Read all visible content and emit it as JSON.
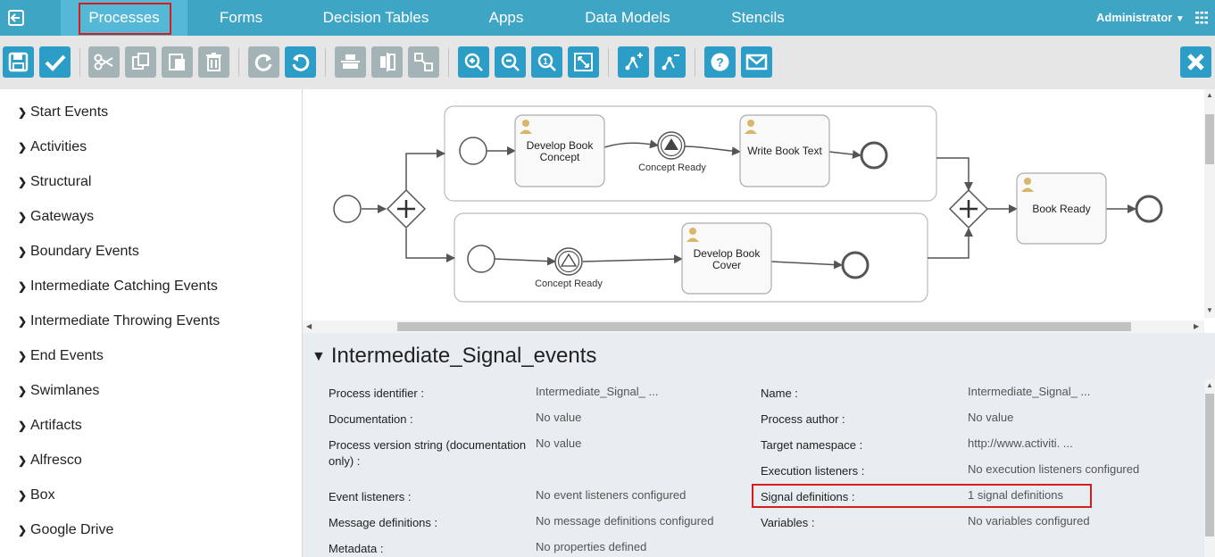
{
  "nav": {
    "tabs": [
      "Processes",
      "Forms",
      "Decision Tables",
      "Apps",
      "Data Models",
      "Stencils"
    ],
    "user": "Administrator"
  },
  "toolbar": {
    "buttons": [
      "save-icon",
      "validate-icon",
      "cut-icon",
      "copy-icon",
      "paste-icon",
      "delete-icon",
      "redo-icon",
      "undo-icon",
      "align-horizontal-icon",
      "align-vertical-icon",
      "same-size-icon",
      "zoom-in-icon",
      "zoom-out-icon",
      "zoom-actual-icon",
      "zoom-fit-icon",
      "bend-add-icon",
      "bend-remove-icon",
      "help-icon",
      "feedback-icon",
      "close-icon"
    ]
  },
  "palette": {
    "items": [
      "Start Events",
      "Activities",
      "Structural",
      "Gateways",
      "Boundary Events",
      "Intermediate Catching Events",
      "Intermediate Throwing Events",
      "End Events",
      "Swimlanes",
      "Artifacts",
      "Alfresco",
      "Box",
      "Google Drive"
    ]
  },
  "diagram": {
    "task1": [
      "Develop Book",
      "Concept"
    ],
    "task2": "Write Book Text",
    "task3": "Book Ready",
    "task4": [
      "Develop Book",
      "Cover"
    ],
    "signal_throw_label": "Concept Ready",
    "signal_catch_label": "Concept Ready"
  },
  "properties": {
    "title": "Intermediate_Signal_events",
    "left": [
      {
        "label": "Process identifier :",
        "value": "Intermediate_Signal_ ..."
      },
      {
        "label": "Documentation :",
        "value": "No value"
      },
      {
        "label": "Process version string (documentation",
        "label2": "only) :",
        "value": "No value"
      },
      {
        "label": "Event listeners :",
        "value": "No event listeners configured"
      },
      {
        "label": "Message definitions :",
        "value": "No message definitions configured"
      },
      {
        "label": "Metadata :",
        "value": "No properties defined"
      }
    ],
    "right": [
      {
        "label": "Name :",
        "value": "Intermediate_Signal_ ..."
      },
      {
        "label": "Process author :",
        "value": "No value"
      },
      {
        "label": "Target namespace :",
        "value": "http://www.activiti. ..."
      },
      {
        "label": "Execution listeners :",
        "value": "No execution listeners configured"
      },
      {
        "label": "Signal definitions :",
        "value": "1 signal definitions"
      },
      {
        "label": "Variables :",
        "value": "No variables configured"
      }
    ]
  },
  "colors": {
    "nav": "#3fa5c5",
    "toolbar_button": "#2c9dc7",
    "highlight": "#d91c1c"
  }
}
